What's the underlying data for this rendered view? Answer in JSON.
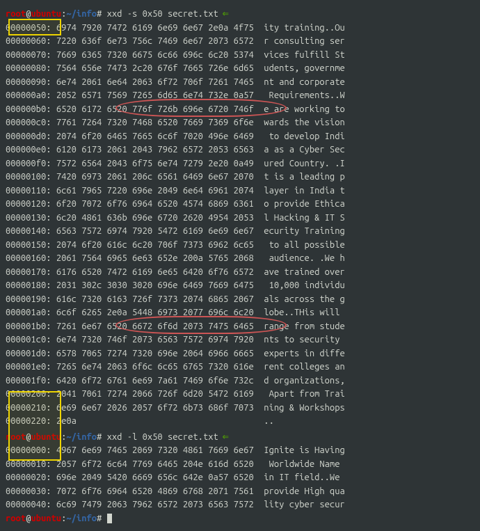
{
  "prompt": {
    "user": "root",
    "host": "ubuntu",
    "path": "~/info",
    "mark": "#"
  },
  "cmd1": "xxd -s 0x50 secret.txt",
  "cmd2": "xxd -l 0x50 secret.txt",
  "block1": [
    {
      "off": "00000050:",
      "hex": "6974 7920 7472 6169 6e69 6e67 2e0a 4f75",
      "asc": "ity training..Ou"
    },
    {
      "off": "00000060:",
      "hex": "7220 636f 6e73 756c 7469 6e67 2073 6572",
      "asc": "r consulting ser"
    },
    {
      "off": "00000070:",
      "hex": "7669 6365 7320 6675 6c66 696c 6c20 5374",
      "asc": "vices fulfill St"
    },
    {
      "off": "00000080:",
      "hex": "7564 656e 7473 2c20 676f 7665 726e 6d65",
      "asc": "udents, governme"
    },
    {
      "off": "00000090:",
      "hex": "6e74 2061 6e64 2063 6f72 706f 7261 7465",
      "asc": "nt and corporate"
    },
    {
      "off": "000000a0:",
      "hex": "2052 6571 7569 7265 6d65 6e74 732e 0a57",
      "asc": " Requirements..W"
    },
    {
      "off": "000000b0:",
      "hex": "6520 6172 6520 776f 726b 696e 6720 746f",
      "asc": "e are working to"
    },
    {
      "off": "000000c0:",
      "hex": "7761 7264 7320 7468 6520 7669 7369 6f6e",
      "asc": "wards the vision"
    },
    {
      "off": "000000d0:",
      "hex": "2074 6f20 6465 7665 6c6f 7020 496e 6469",
      "asc": " to develop Indi"
    },
    {
      "off": "000000e0:",
      "hex": "6120 6173 2061 2043 7962 6572 2053 6563",
      "asc": "a as a Cyber Sec"
    },
    {
      "off": "000000f0:",
      "hex": "7572 6564 2043 6f75 6e74 7279 2e20 0a49",
      "asc": "ured Country. .I"
    },
    {
      "off": "00000100:",
      "hex": "7420 6973 2061 206c 6561 6469 6e67 2070",
      "asc": "t is a leading p"
    },
    {
      "off": "00000110:",
      "hex": "6c61 7965 7220 696e 2049 6e64 6961 2074",
      "asc": "layer in India t"
    },
    {
      "off": "00000120:",
      "hex": "6f20 7072 6f76 6964 6520 4574 6869 6361",
      "asc": "o provide Ethica"
    },
    {
      "off": "00000130:",
      "hex": "6c20 4861 636b 696e 6720 2620 4954 2053",
      "asc": "l Hacking & IT S"
    },
    {
      "off": "00000140:",
      "hex": "6563 7572 6974 7920 5472 6169 6e69 6e67",
      "asc": "ecurity Training"
    },
    {
      "off": "00000150:",
      "hex": "2074 6f20 616c 6c20 706f 7373 6962 6c65",
      "asc": " to all possible"
    },
    {
      "off": "00000160:",
      "hex": "2061 7564 6965 6e63 652e 200a 5765 2068",
      "asc": " audience. .We h"
    },
    {
      "off": "00000170:",
      "hex": "6176 6520 7472 6169 6e65 6420 6f76 6572",
      "asc": "ave trained over"
    },
    {
      "off": "00000180:",
      "hex": "2031 302c 3030 3020 696e 6469 7669 6475",
      "asc": " 10,000 individu"
    },
    {
      "off": "00000190:",
      "hex": "616c 7320 6163 726f 7373 2074 6865 2067",
      "asc": "als across the g"
    },
    {
      "off": "000001a0:",
      "hex": "6c6f 6265 2e0a 5448 6973 2077 696c 6c20",
      "asc": "lobe..THis will "
    },
    {
      "off": "000001b0:",
      "hex": "7261 6e67 6520 6672 6f6d 2073 7475 6465",
      "asc": "range from stude"
    },
    {
      "off": "000001c0:",
      "hex": "6e74 7320 746f 2073 6563 7572 6974 7920",
      "asc": "nts to security "
    },
    {
      "off": "000001d0:",
      "hex": "6578 7065 7274 7320 696e 2064 6966 6665",
      "asc": "experts in diffe"
    },
    {
      "off": "000001e0:",
      "hex": "7265 6e74 2063 6f6c 6c65 6765 7320 616e",
      "asc": "rent colleges an"
    },
    {
      "off": "000001f0:",
      "hex": "6420 6f72 6761 6e69 7a61 7469 6f6e 732c",
      "asc": "d organizations,"
    },
    {
      "off": "00000200:",
      "hex": "2041 7061 7274 2066 726f 6d20 5472 6169",
      "asc": " Apart from Trai"
    },
    {
      "off": "00000210:",
      "hex": "6e69 6e67 2026 2057 6f72 6b73 686f 7073",
      "asc": "ning & Workshops"
    },
    {
      "off": "00000220:",
      "hex": "2e0a",
      "asc": ".."
    }
  ],
  "block2": [
    {
      "off": "00000000:",
      "hex": "4967 6e69 7465 2069 7320 4861 7669 6e67",
      "asc": "Ignite is Having"
    },
    {
      "off": "00000010:",
      "hex": "2057 6f72 6c64 7769 6465 204e 616d 6520",
      "asc": " Worldwide Name "
    },
    {
      "off": "00000020:",
      "hex": "696e 2049 5420 6669 656c 642e 0a57 6520",
      "asc": "in IT field..We "
    },
    {
      "off": "00000030:",
      "hex": "7072 6f76 6964 6520 4869 6768 2071 7561",
      "asc": "provide High qua"
    },
    {
      "off": "00000040:",
      "hex": "6c69 7479 2063 7962 6572 2073 6563 7572",
      "asc": "lity cyber secur"
    }
  ],
  "highlights": {
    "box1_desc": "yellow box around offset 00000050",
    "box2_desc": "yellow box around offsets 00000000-00000040",
    "circle1_desc": "red circle on hex 'working to'",
    "circle2_desc": "red circle on hex 'to security'"
  }
}
